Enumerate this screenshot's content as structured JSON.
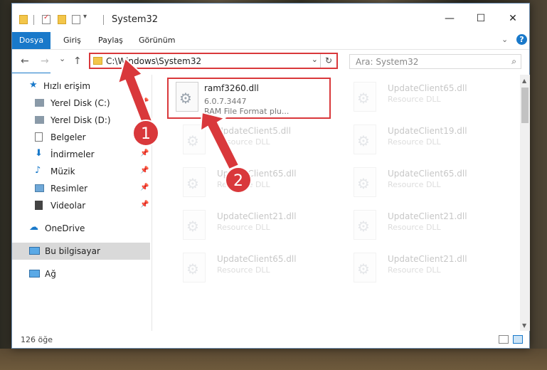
{
  "window": {
    "title": "System32",
    "minimize": "—",
    "maximize": "☐",
    "close": "✕"
  },
  "ribbon": {
    "tabs": [
      "Dosya",
      "Giriş",
      "Paylaş",
      "Görünüm"
    ],
    "help": "?"
  },
  "nav": {
    "address": "C:\\Windows\\System32",
    "search_placeholder": "Ara: System32",
    "back": "←",
    "forward": "→",
    "recent": "⌄",
    "up": "↑",
    "refresh": "↻",
    "dropdown": "⌄",
    "search_icon": "⌕"
  },
  "sidebar": {
    "items": [
      {
        "label": "Hızlı erişim",
        "icon": "star-icon"
      },
      {
        "label": "Yerel Disk (C:)",
        "icon": "drive-icon",
        "pinned": true
      },
      {
        "label": "Yerel Disk (D:)",
        "icon": "drive-icon",
        "pinned": true
      },
      {
        "label": "Belgeler",
        "icon": "document-icon",
        "pinned": true
      },
      {
        "label": "İndirmeler",
        "icon": "download-icon",
        "pinned": true
      },
      {
        "label": "Müzik",
        "icon": "music-icon",
        "pinned": true
      },
      {
        "label": "Resimler",
        "icon": "pictures-icon",
        "pinned": true
      },
      {
        "label": "Videolar",
        "icon": "video-icon",
        "pinned": true
      },
      {
        "label": "OneDrive",
        "icon": "cloud-icon"
      },
      {
        "label": "Bu bilgisayar",
        "icon": "computer-icon",
        "selected": true
      },
      {
        "label": "Ağ",
        "icon": "network-icon"
      }
    ]
  },
  "files": [
    {
      "name": "ramf3260.dll",
      "version": "6.0.7.3447",
      "description": "RAM File Format plu...",
      "highlighted": true
    },
    {
      "name": "UpdateClient65.dll",
      "description": "Resource DLL"
    },
    {
      "name": "UpdateClient5.dll",
      "description": "Resource DLL"
    },
    {
      "name": "UpdateClient19.dll",
      "description": "Resource DLL"
    },
    {
      "name": "UpdateClient65.dll",
      "description": "Resource DLL"
    },
    {
      "name": "UpdateClient65.dll",
      "description": "Resource DLL"
    },
    {
      "name": "UpdateClient21.dll",
      "description": "Resource DLL"
    },
    {
      "name": "UpdateClient21.dll",
      "description": "Resource DLL"
    },
    {
      "name": "UpdateClient65.dll",
      "description": "Resource DLL"
    },
    {
      "name": "UpdateClient21.dll",
      "description": "Resource DLL"
    }
  ],
  "status": {
    "count": "126 öğe"
  },
  "annotations": {
    "step1": "1",
    "step2": "2",
    "color": "#d9383b"
  }
}
